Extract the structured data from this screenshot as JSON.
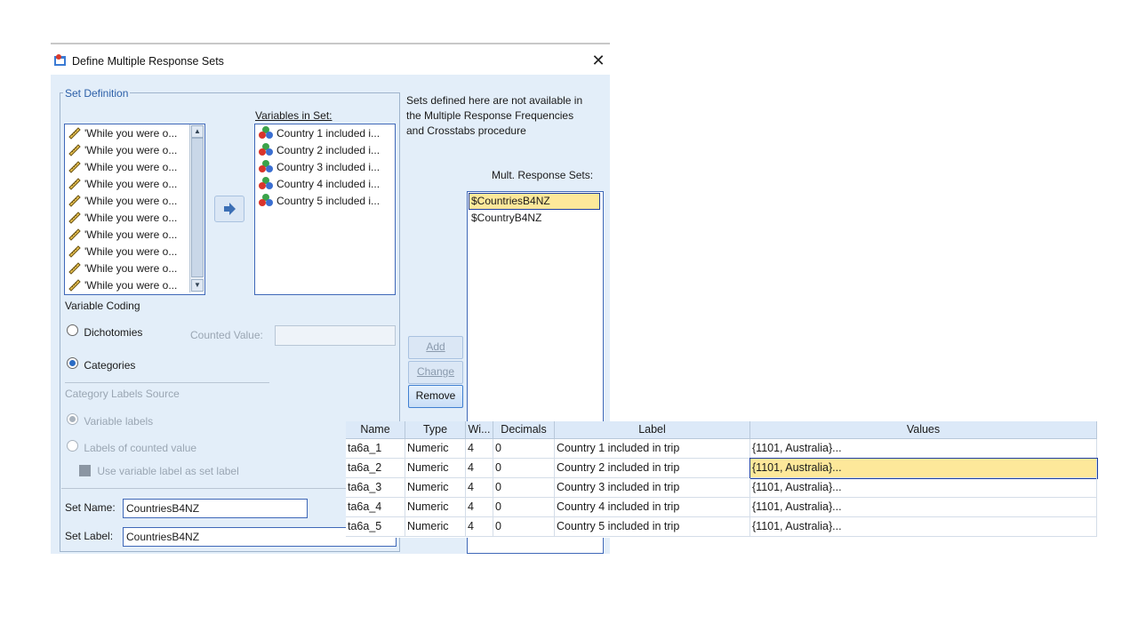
{
  "dialog": {
    "title": "Define Multiple Response Sets",
    "close_glyph": "✕",
    "set_definition_legend": "Set Definition",
    "source_variables": [
      "'While you were o...",
      "'While you were o...",
      "'While you were o...",
      "'While you were o...",
      "'While you were o...",
      "'While you were o...",
      "'While you were o...",
      "'While you were o...",
      "'While you were o...",
      "'While you were o..."
    ],
    "variables_in_set_label": "Variables in Set:",
    "variables_in_set": [
      "Country 1 included i...",
      "Country 2 included i...",
      "Country 3 included i...",
      "Country 4 included i...",
      "Country 5 included i..."
    ],
    "info_text_1": "Sets defined here are not available in",
    "info_text_2": "the Multiple Response Frequencies",
    "info_text_3": "and Crosstabs procedure",
    "mult_response_label": "Mult. Response Sets:",
    "mult_response_sets": [
      "$CountriesB4NZ",
      "$CountryB4NZ"
    ],
    "variable_coding_label": "Variable Coding",
    "dichotomies_label": "Dichotomies",
    "counted_value_label": "Counted Value:",
    "categories_label": "Categories",
    "category_labels_source": "Category Labels Source",
    "variable_labels_option": "Variable labels",
    "labels_counted_option": "Labels of counted value",
    "use_var_label_option": "Use variable label as set label",
    "set_name_label": "Set Name:",
    "set_name_value": "CountriesB4NZ",
    "set_label_label": "Set Label:",
    "set_label_value": "CountriesB4NZ",
    "add_button": "Add",
    "change_button": "Change",
    "remove_button": "Remove"
  },
  "grid": {
    "headers": [
      "Name",
      "Type",
      "Wi...",
      "Decimals",
      "Label",
      "Values"
    ],
    "rows": [
      [
        "ta6a_1",
        "Numeric",
        "4",
        "0",
        "Country 1 included in trip",
        "{1101, Australia}..."
      ],
      [
        "ta6a_2",
        "Numeric",
        "4",
        "0",
        "Country 2 included in trip",
        "{1101, Australia}..."
      ],
      [
        "ta6a_3",
        "Numeric",
        "4",
        "0",
        "Country 3 included in trip",
        "{1101, Australia}..."
      ],
      [
        "ta6a_4",
        "Numeric",
        "4",
        "0",
        "Country 4 included in trip",
        "{1101, Australia}..."
      ],
      [
        "ta6a_5",
        "Numeric",
        "4",
        "0",
        "Country 5 included in trip",
        "{1101, Australia}..."
      ]
    ]
  },
  "colors": {
    "dialog_bg": "#e3eef9",
    "selection": "#fde89a",
    "accent": "#3f68b8"
  },
  "icons": {
    "ruler": "ruler-icon",
    "nominal": "nominal-measure-icon",
    "arrow": "move-right-arrow-icon"
  }
}
